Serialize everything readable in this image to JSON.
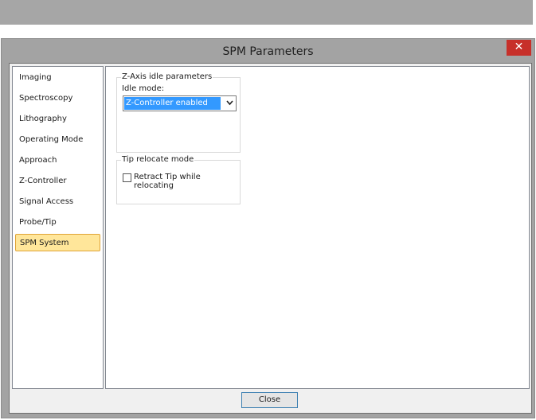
{
  "window": {
    "title": "SPM Parameters",
    "close_glyph": "✕"
  },
  "nav": {
    "items": [
      {
        "label": "Imaging"
      },
      {
        "label": "Spectroscopy"
      },
      {
        "label": "Lithography"
      },
      {
        "label": "Operating Mode"
      },
      {
        "label": "Approach"
      },
      {
        "label": "Z-Controller"
      },
      {
        "label": "Signal Access"
      },
      {
        "label": "Probe/Tip"
      },
      {
        "label": "SPM System"
      }
    ],
    "selected": "SPM System"
  },
  "zaxis": {
    "legend": "Z-Axis idle parameters",
    "idle_label": "Idle mode:",
    "idle_value": "Z-Controller enabled"
  },
  "tip": {
    "legend": "Tip relocate mode",
    "retract_label": "Retract Tip while relocating",
    "retract_checked": false
  },
  "footer": {
    "close_label": "Close"
  },
  "colors": {
    "selection": "#3399ff",
    "active_nav": "#ffe69a",
    "close_red": "#c7302a"
  }
}
